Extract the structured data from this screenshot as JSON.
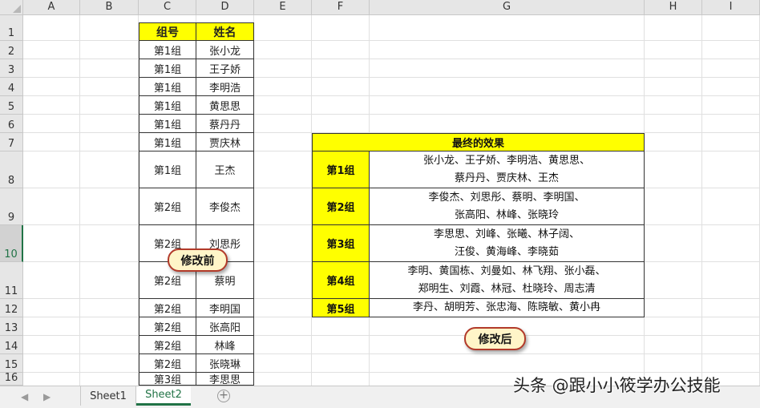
{
  "columns": [
    "A",
    "B",
    "C",
    "D",
    "E",
    "F",
    "G",
    "H",
    "I"
  ],
  "rows": [
    "1",
    "2",
    "3",
    "4",
    "5",
    "6",
    "7",
    "8",
    "9",
    "10",
    "11",
    "12",
    "13",
    "14",
    "15",
    "16"
  ],
  "selected_row": "10",
  "source_table": {
    "headers": [
      "组号",
      "姓名"
    ],
    "rows": [
      [
        "第1组",
        "张小龙"
      ],
      [
        "第1组",
        "王子娇"
      ],
      [
        "第1组",
        "李明浩"
      ],
      [
        "第1组",
        "黄思思"
      ],
      [
        "第1组",
        "蔡丹丹"
      ],
      [
        "第1组",
        "贾庆林"
      ],
      [
        "第1组",
        "王杰"
      ],
      [
        "第2组",
        "李俊杰"
      ],
      [
        "第2组",
        "刘思彤"
      ],
      [
        "第2组",
        "蔡明"
      ],
      [
        "第2组",
        "李明国"
      ],
      [
        "第2组",
        "张高阳"
      ],
      [
        "第2组",
        "林峰"
      ],
      [
        "第2组",
        "张晓琳"
      ],
      [
        "第3组",
        "李思思"
      ]
    ]
  },
  "result_table": {
    "title": "最终的效果",
    "groups": [
      {
        "label": "第1组",
        "lines": [
          "张小龙、王子娇、李明浩、黄思思、",
          "蔡丹丹、贾庆林、王杰"
        ]
      },
      {
        "label": "第2组",
        "lines": [
          "李俊杰、刘思彤、蔡明、李明国、",
          "张高阳、林峰、张晓玲"
        ]
      },
      {
        "label": "第3组",
        "lines": [
          "李思思、刘峰、张曦、林子阔、",
          "汪俊、黄海峰、李晓茹"
        ]
      },
      {
        "label": "第4组",
        "lines": [
          "李明、黄国栋、刘曼如、林飞翔、张小磊、",
          "郑明生、刘霞、林冠、杜晓玲、周志清"
        ]
      },
      {
        "label": "第5组",
        "lines": [
          "李丹、胡明芳、张忠海、陈晓敏、黄小冉"
        ]
      }
    ]
  },
  "callouts": {
    "before": "修改前",
    "after": "修改后"
  },
  "sheet_tabs": [
    "Sheet1",
    "Sheet2"
  ],
  "active_sheet": "Sheet2",
  "watermark": "头条 @跟小小筱学办公技能",
  "colors": {
    "header_fill": "#ffff00",
    "grid": "#e0e0e0",
    "excel_green": "#217346",
    "callout_border": "#b23a2a",
    "callout_fill": "#fff5c8"
  }
}
